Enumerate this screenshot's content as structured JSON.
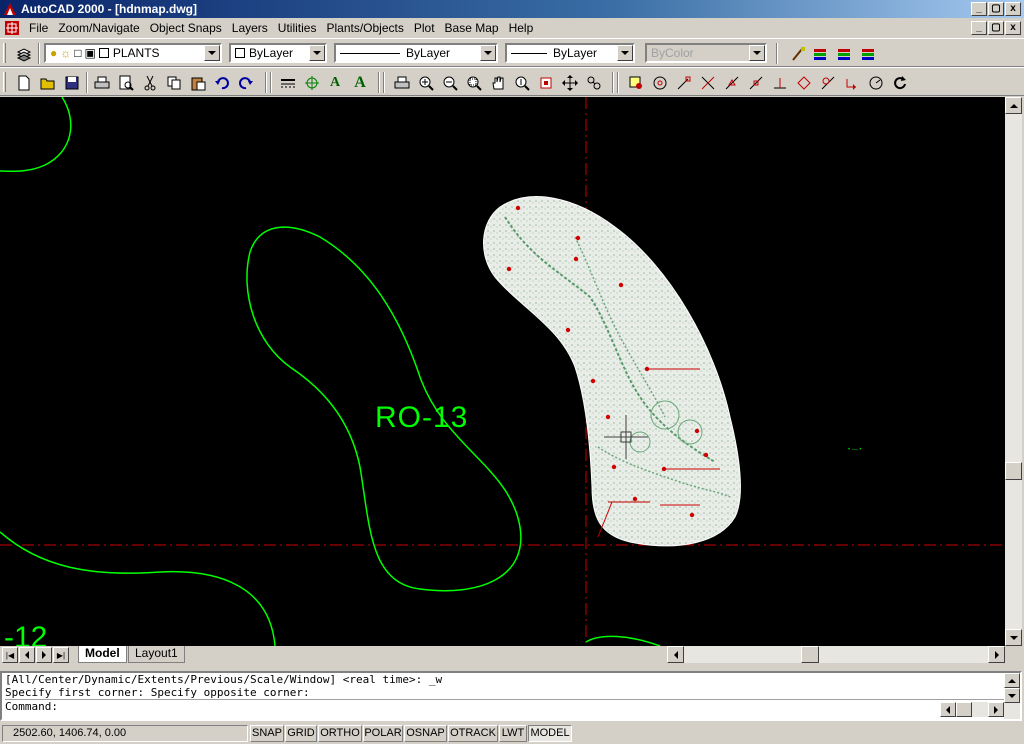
{
  "window": {
    "title": "AutoCAD 2000 - [hdnmap.dwg]",
    "controls": [
      "_",
      "▢",
      "x"
    ]
  },
  "menu": [
    "File",
    "Zoom/Navigate",
    "Object Snaps",
    "Layers",
    "Utilities",
    "Plants/Objects",
    "Plot",
    "Base Map",
    "Help"
  ],
  "properties_toolbar": {
    "layer": "PLANTS",
    "color": "ByLayer",
    "linetype": "ByLayer",
    "lineweight": "ByLayer",
    "plotstyle": "ByColor"
  },
  "drawing": {
    "label_main": "RO-13",
    "label_corner": "-12",
    "bg_color": "#000000",
    "contour_color": "#00ff00",
    "axis_color": "#cc0000"
  },
  "tabs": [
    "Model",
    "Layout1"
  ],
  "active_tab": "Model",
  "command_lines": [
    "[All/Center/Dynamic/Extents/Previous/Scale/Window] <real time>: _w",
    "Specify first corner: Specify opposite corner:",
    "Command:"
  ],
  "status": {
    "coords": "2502.60, 1406.74, 0.00",
    "toggles": [
      "SNAP",
      "GRID",
      "ORTHO",
      "POLAR",
      "OSNAP",
      "OTRACK",
      "LWT",
      "MODEL"
    ],
    "active_toggle": "MODEL"
  }
}
